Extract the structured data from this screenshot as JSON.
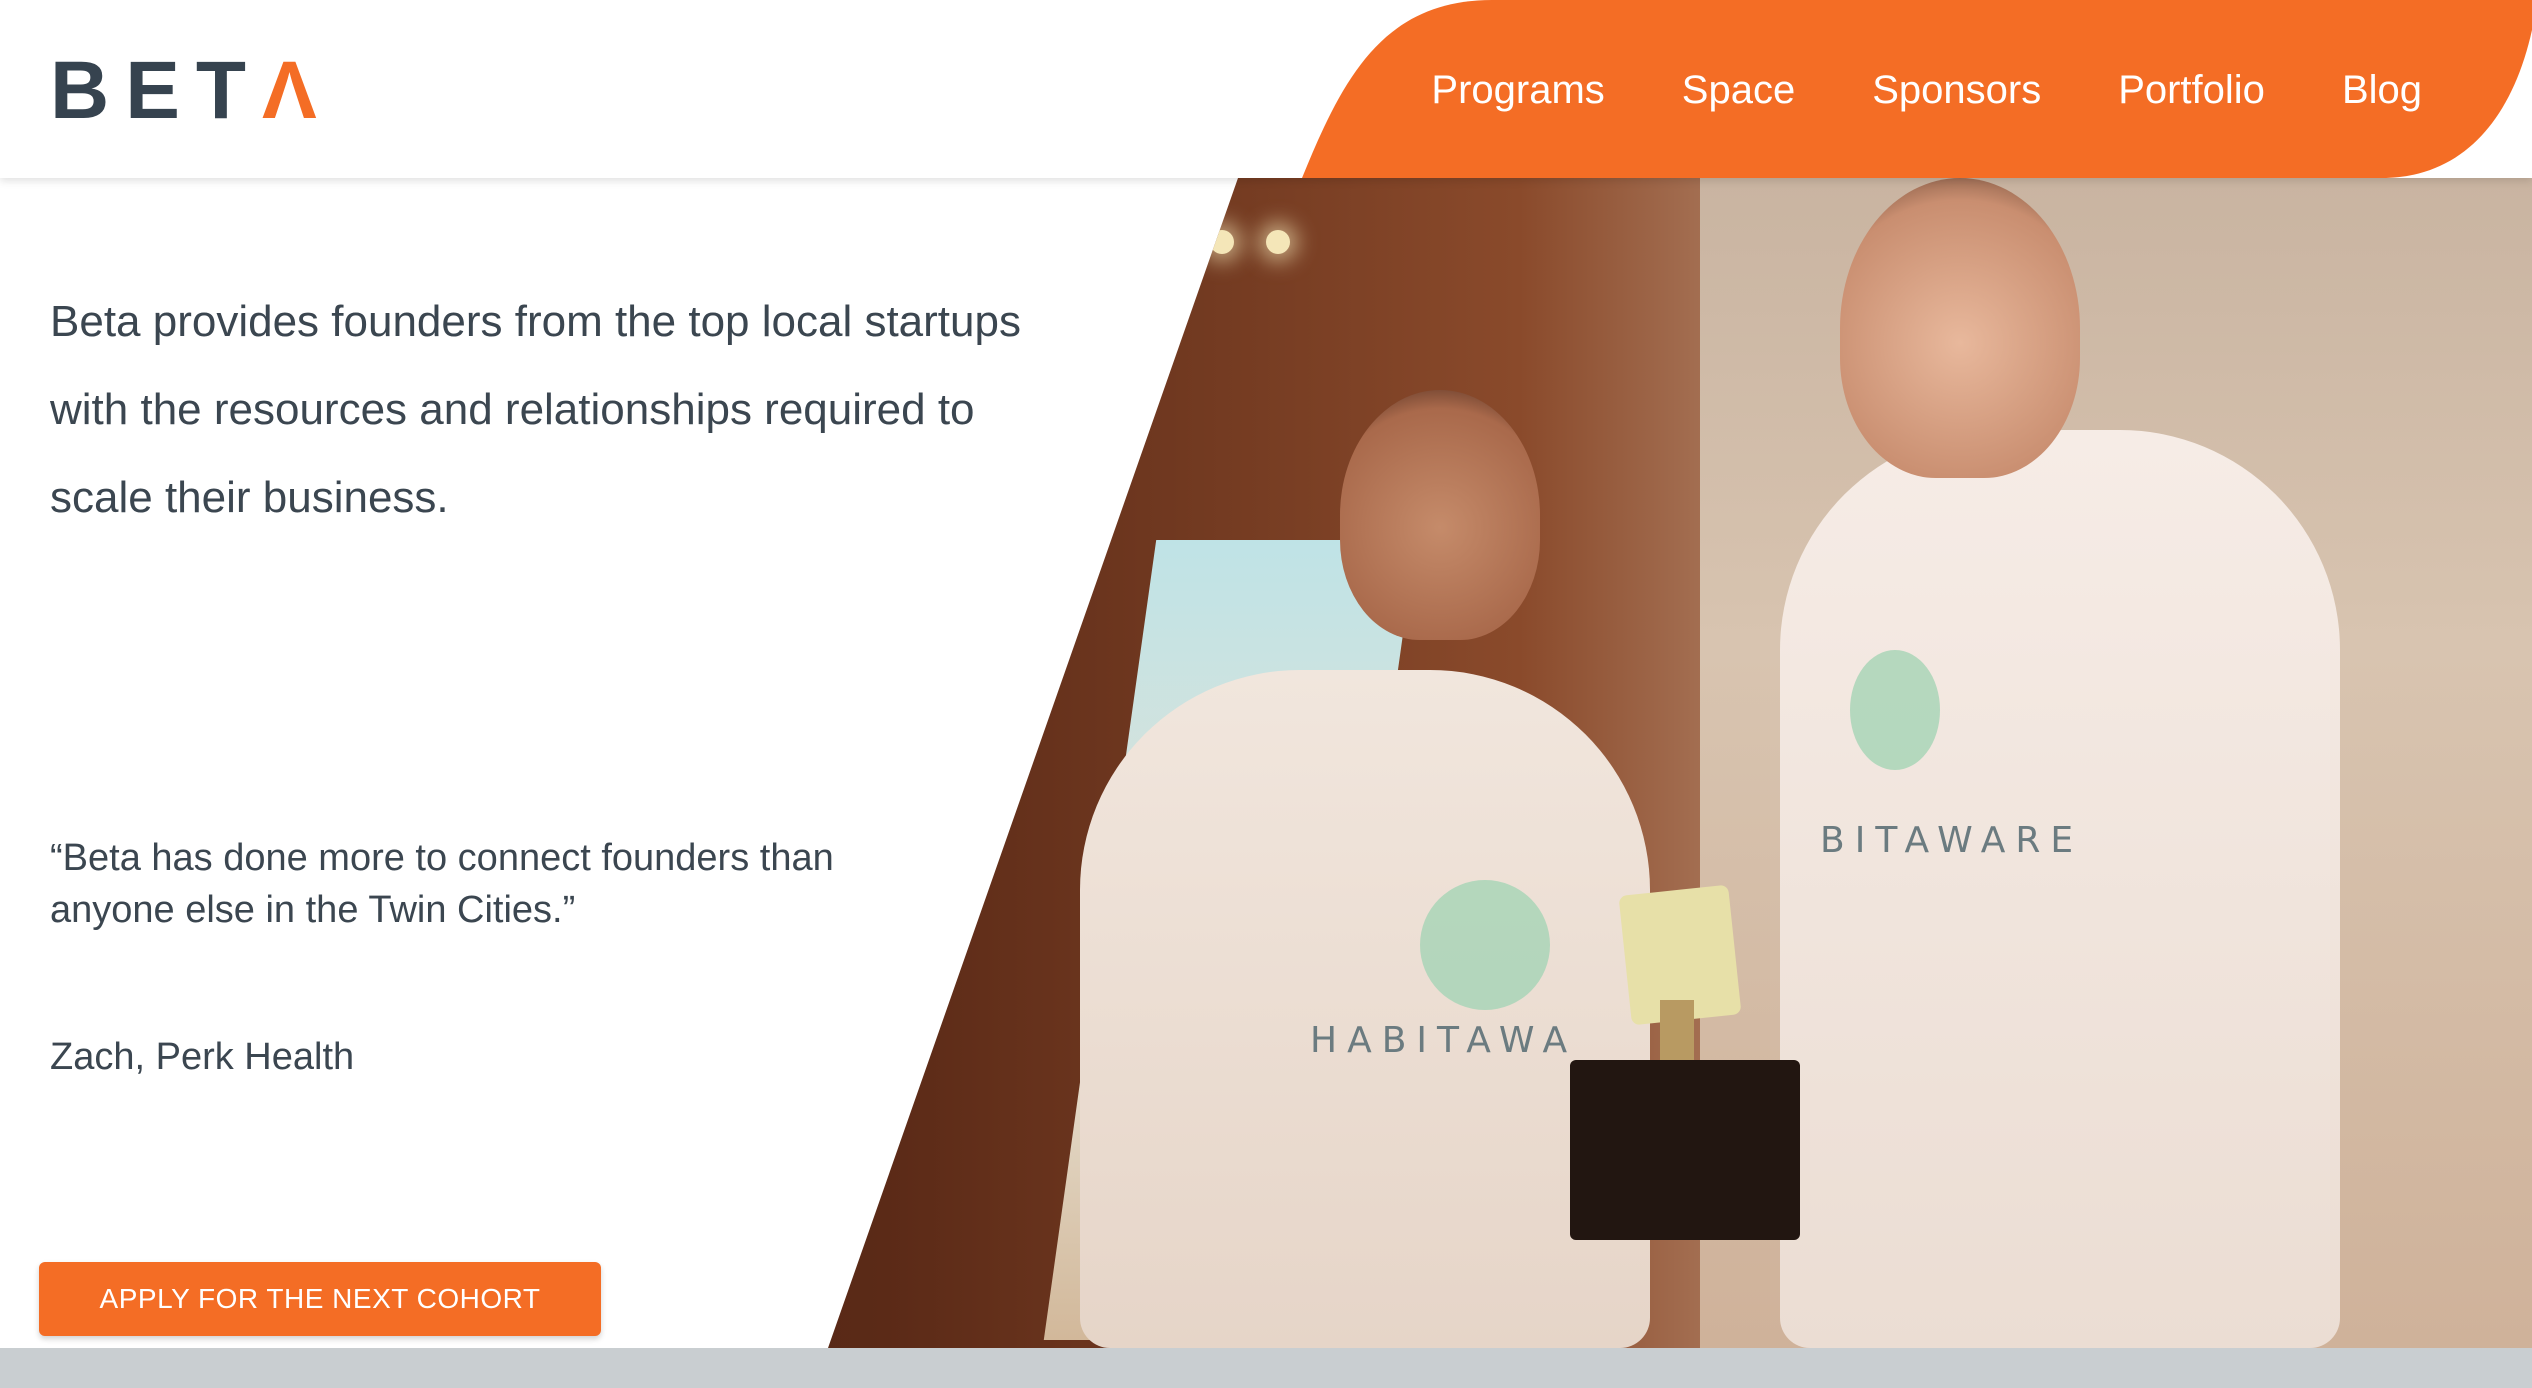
{
  "brand": {
    "logo_text": "BET",
    "logo_accent": "Λ",
    "primary_color": "#36434f",
    "accent_color": "#f46d25"
  },
  "nav": {
    "items": [
      {
        "label": "Programs"
      },
      {
        "label": "Space"
      },
      {
        "label": "Sponsors"
      },
      {
        "label": "Portfolio"
      },
      {
        "label": "Blog"
      }
    ]
  },
  "hero": {
    "lead": "Beta provides founders from the top local startups with the resources and relationships required to scale their business.",
    "quote": "“Beta has done more to connect founders than anyone else in the Twin Cities.”",
    "attribution": "Zach, Perk Health",
    "cta_label": "APPLY FOR THE NEXT COHORT",
    "photo": {
      "shirt_text_left": "HABITAWA",
      "shirt_text_right": "BITAWARE",
      "icon": "photo-of-founders-with-trophy"
    }
  }
}
